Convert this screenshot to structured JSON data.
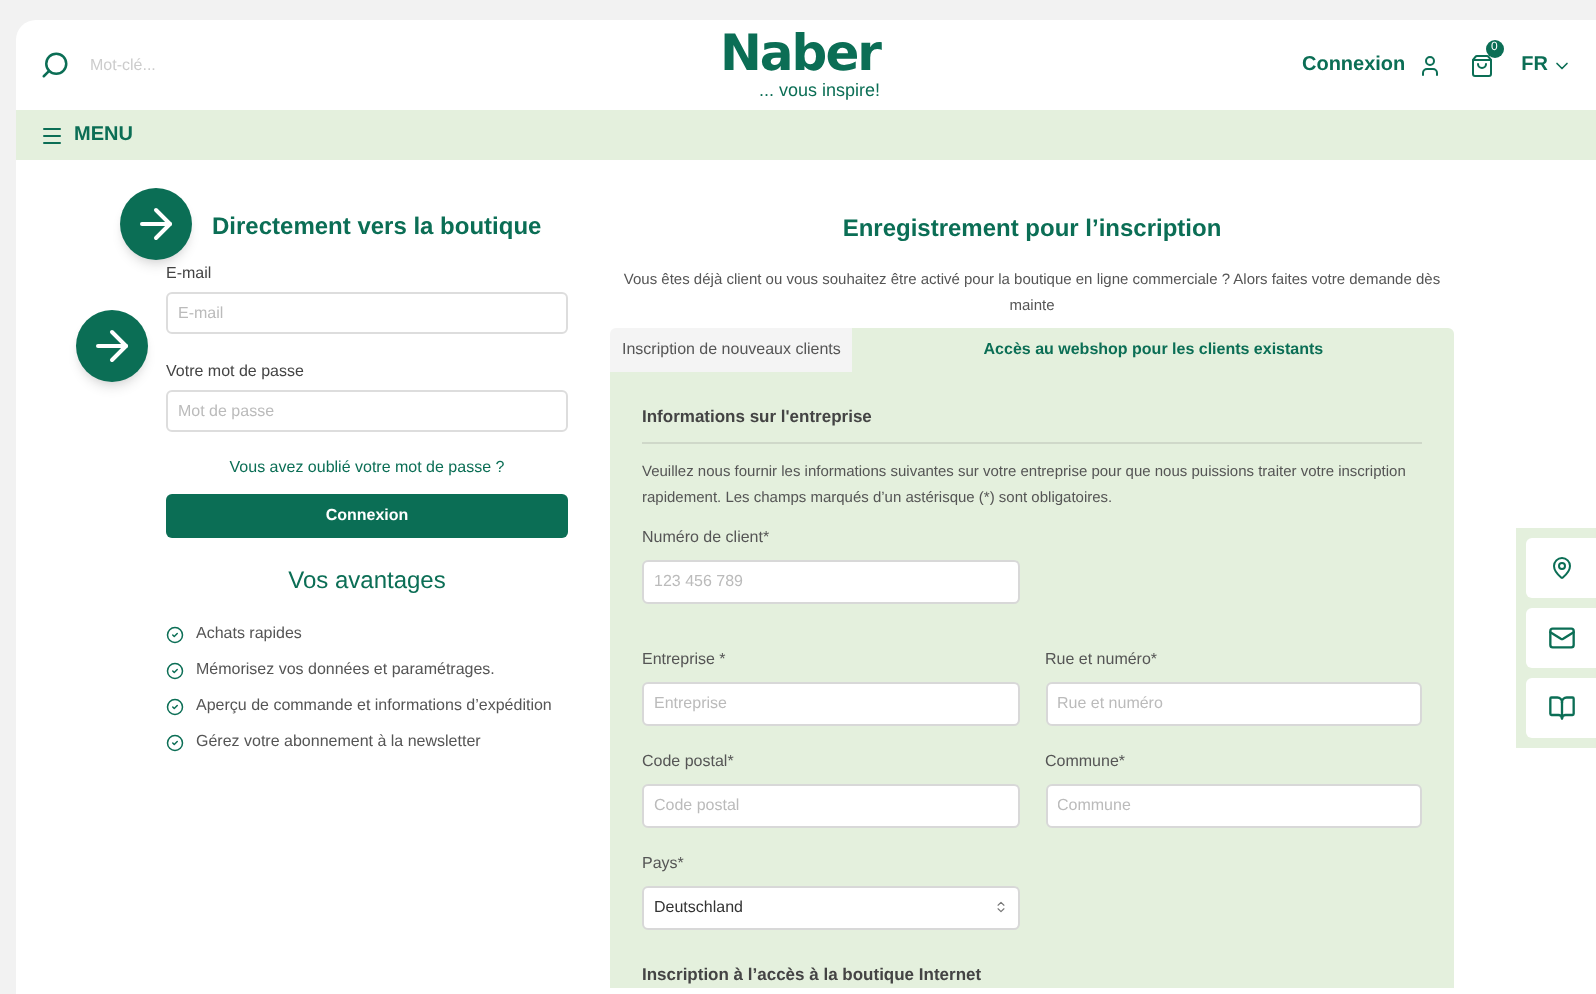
{
  "header": {
    "search_placeholder": "Mot-clé...",
    "logo": "Naber",
    "tagline": "... vous inspire!",
    "login": "Connexion",
    "cart_count": "0",
    "language": "FR"
  },
  "menu": {
    "label": "MENU"
  },
  "login_panel": {
    "title": "Directement vers la boutique",
    "email_label": "E-mail",
    "email_placeholder": "E-mail",
    "password_label": "Votre mot de passe",
    "password_placeholder": "Mot de passe",
    "forgot_link": "Vous avez oublié votre mot de passe ?",
    "submit": "Connexion"
  },
  "advantages": {
    "title": "Vos avantages",
    "items": [
      "Achats rapides",
      "Mémorisez vos données et paramétrages.",
      "Aperçu de commande et informations d’expédition",
      "Gérez votre abonnement à la newsletter"
    ]
  },
  "registration": {
    "title": "Enregistrement pour l’inscription",
    "intro": "Vous êtes déjà client ou vous souhaitez être activé pour la boutique en ligne commerciale ? Alors faites votre demande dès mainte",
    "tabs": [
      {
        "label": "Inscription de nouveaux clients",
        "selected": false
      },
      {
        "label": "Accès au webshop pour les clients existants",
        "selected": true
      }
    ],
    "section_title": "Informations sur l'entreprise",
    "section_text": "Veuillez nous fournir les informations suivantes sur votre entreprise pour que nous puissions traiter votre inscription rapidement. Les champs marqués d’un astérisque (*) sont obligatoires.",
    "rows": [
      [
        {
          "kind": "input",
          "label": "Numéro de client*",
          "placeholder": "123 456 789"
        }
      ],
      [
        {
          "kind": "input",
          "label": "Entreprise *",
          "placeholder": "Entreprise"
        },
        {
          "kind": "input",
          "label": "Rue et numéro*",
          "placeholder": "Rue et numéro"
        }
      ],
      [
        {
          "kind": "input",
          "label": "Code postal*",
          "placeholder": "Code postal"
        },
        {
          "kind": "input",
          "label": "Commune*",
          "placeholder": "Commune"
        }
      ],
      [
        {
          "kind": "select",
          "label": "Pays*",
          "value": "Deutschland"
        }
      ]
    ],
    "next_section_title": "Inscription à l’accès à la boutique Internet"
  }
}
